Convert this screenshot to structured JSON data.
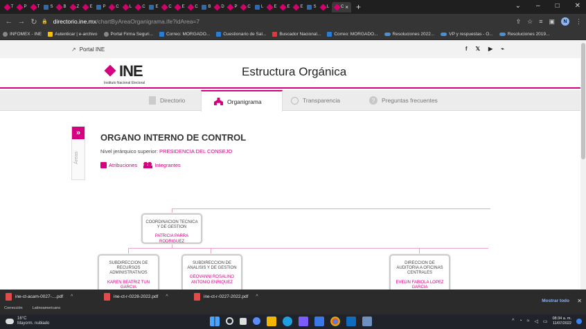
{
  "browser": {
    "tabs": [
      "T",
      "P",
      "T",
      "S",
      "B",
      "Z",
      "E",
      "P",
      "C",
      "L",
      "C",
      "E",
      "C",
      "E",
      "C",
      "B",
      "D",
      "P",
      "C",
      "L",
      "E",
      "E",
      "E",
      "S",
      "L",
      "C"
    ],
    "active_tab_close": "×",
    "new_tab": "+",
    "window_controls": [
      "⌄",
      "–",
      "□",
      "✕"
    ],
    "url_host": "directorio.ine.mx",
    "url_path": "/chartByAreaOrganigrama.ife?idArea=7",
    "profile_initial": "N"
  },
  "bookmarks": [
    {
      "label": "INFOMEX - INE",
      "icon": "globe-icon"
    },
    {
      "label": "Autenticar | e-archivo",
      "icon": "earchivo-icon"
    },
    {
      "label": "Portal Firma Seguri...",
      "icon": "globe-icon"
    },
    {
      "label": "Correo: MORGADO...",
      "icon": "outlook-icon"
    },
    {
      "label": "Cuestionario de Sal...",
      "icon": "forms-icon"
    },
    {
      "label": "Buscador Nacional...",
      "icon": "search-icon"
    },
    {
      "label": "Correo: MORGADO...",
      "icon": "outlook-icon"
    },
    {
      "label": "Resoluciones 2022...",
      "icon": "cloud-icon"
    },
    {
      "label": "VP y respuestas - O...",
      "icon": "cloud-icon"
    },
    {
      "label": "Resoluciones 2019...",
      "icon": "cloud-icon"
    }
  ],
  "site": {
    "portal_link": "Portal INE",
    "social": [
      "f",
      "𝕏",
      "▶",
      "⌁"
    ],
    "logo_text": "INE",
    "logo_subtitle": "Instituto Nacional Electoral",
    "title": "Estructura Orgánica"
  },
  "nav_tabs": [
    {
      "label": "Directorio"
    },
    {
      "label": "Organigrama"
    },
    {
      "label": "Transparencia"
    },
    {
      "label": "Preguntas frecuentes"
    }
  ],
  "areas": {
    "toggle": "»",
    "label": "Áreas"
  },
  "org": {
    "title": "ORGANO INTERNO DE CONTROL",
    "superior_label": "Nivel jerárquico superior: ",
    "superior_link": "PRESIDENCIA DEL CONSEJO",
    "atribuciones": "Atribuciones",
    "integrantes": "Integrantes"
  },
  "nodes": [
    {
      "title": "COORDINACION TECNICA Y DE GESTION",
      "person": "PATRICIA PARRA RODRIGUEZ"
    },
    {
      "title": "SUBDIRECCION DE RECURSOS ADMINISTRATIVOS",
      "person": "KAREN BEATRIZ TUN GARCIA"
    },
    {
      "title": "SUBDIRECCION DE ANALISIS Y DE GESTION",
      "person": "GEOVANNI ROSALINO ANTONIO ENRIQUEZ"
    },
    {
      "title": "DIRECCION DE AUDITORIA A OFICINAS CENTRALES",
      "person": "EVELIN FABIOLA LOPEZ GARCIA"
    }
  ],
  "downloads": {
    "items": [
      "ine-ct-acam-0027-....pdf",
      "ine-ct-r-0228-2022.pdf",
      "ine-ct-r-0227-2022.pdf"
    ],
    "show_all": "Mostrar todo",
    "close": "✕",
    "thumbs": [
      "Corrección",
      "Latinoamericano"
    ]
  },
  "taskbar": {
    "temperature": "16°C",
    "weather": "Mayorm. nublado",
    "time": "08:34 a. m.",
    "date": "11/07/2022",
    "tray": "^"
  }
}
